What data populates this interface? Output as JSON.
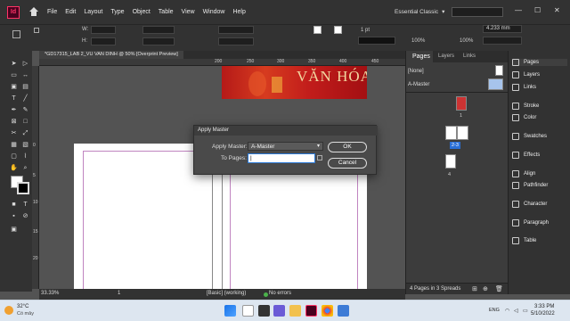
{
  "app": {
    "logo": "Id"
  },
  "menu": [
    "File",
    "Edit",
    "Layout",
    "Type",
    "Object",
    "Table",
    "View",
    "Window",
    "Help"
  ],
  "workspace": "Essential Classic",
  "control_bar": {
    "stroke_weight": "1 pt",
    "opacity": "100%",
    "scale_pct": "100%",
    "ref_value": "4.233 mm",
    "field_w": "W:",
    "field_h": "H:"
  },
  "document_tab": "*GD17315_LAB 2_VU VAN DINH @ 50% [Overprint Preview]",
  "ruler": {
    "h": [
      "200",
      "250",
      "300",
      "350",
      "400",
      "450"
    ],
    "v": [
      "0",
      "5",
      "10",
      "15",
      "20"
    ]
  },
  "banner": {
    "title": "VĂN HÓA"
  },
  "status": {
    "zoom": "33.33%",
    "page": "1",
    "preflight": "[Basic] (working)",
    "errors": "No errors"
  },
  "pages_panel": {
    "tabs": [
      "Pages",
      "Layers",
      "Links"
    ],
    "none_master": "[None]",
    "a_master": "A-Master",
    "page_labels": [
      "1",
      "2-3",
      "4"
    ],
    "footer": "4 Pages in 3 Spreads"
  },
  "dock": [
    "Pages",
    "Layers",
    "Links",
    "Stroke",
    "Color",
    "Swatches",
    "Effects",
    "Align",
    "Pathfinder",
    "Character",
    "Paragraph",
    "Table"
  ],
  "dialog": {
    "title": "Apply Master",
    "apply_label": "Apply Master:",
    "apply_value": "A-Master",
    "to_label": "To Pages:",
    "to_value": "|",
    "ok": "OK",
    "cancel": "Cancel"
  },
  "taskbar": {
    "temp": "32°C",
    "weather": "Có mây",
    "lang": "ENG",
    "time": "3:33 PM",
    "date": "5/10/2022"
  },
  "colors": {
    "accent": "#2a78d6",
    "app_brand": "#ff3366",
    "dark_bg": "#323232",
    "banner_red": "#c21d1b"
  }
}
